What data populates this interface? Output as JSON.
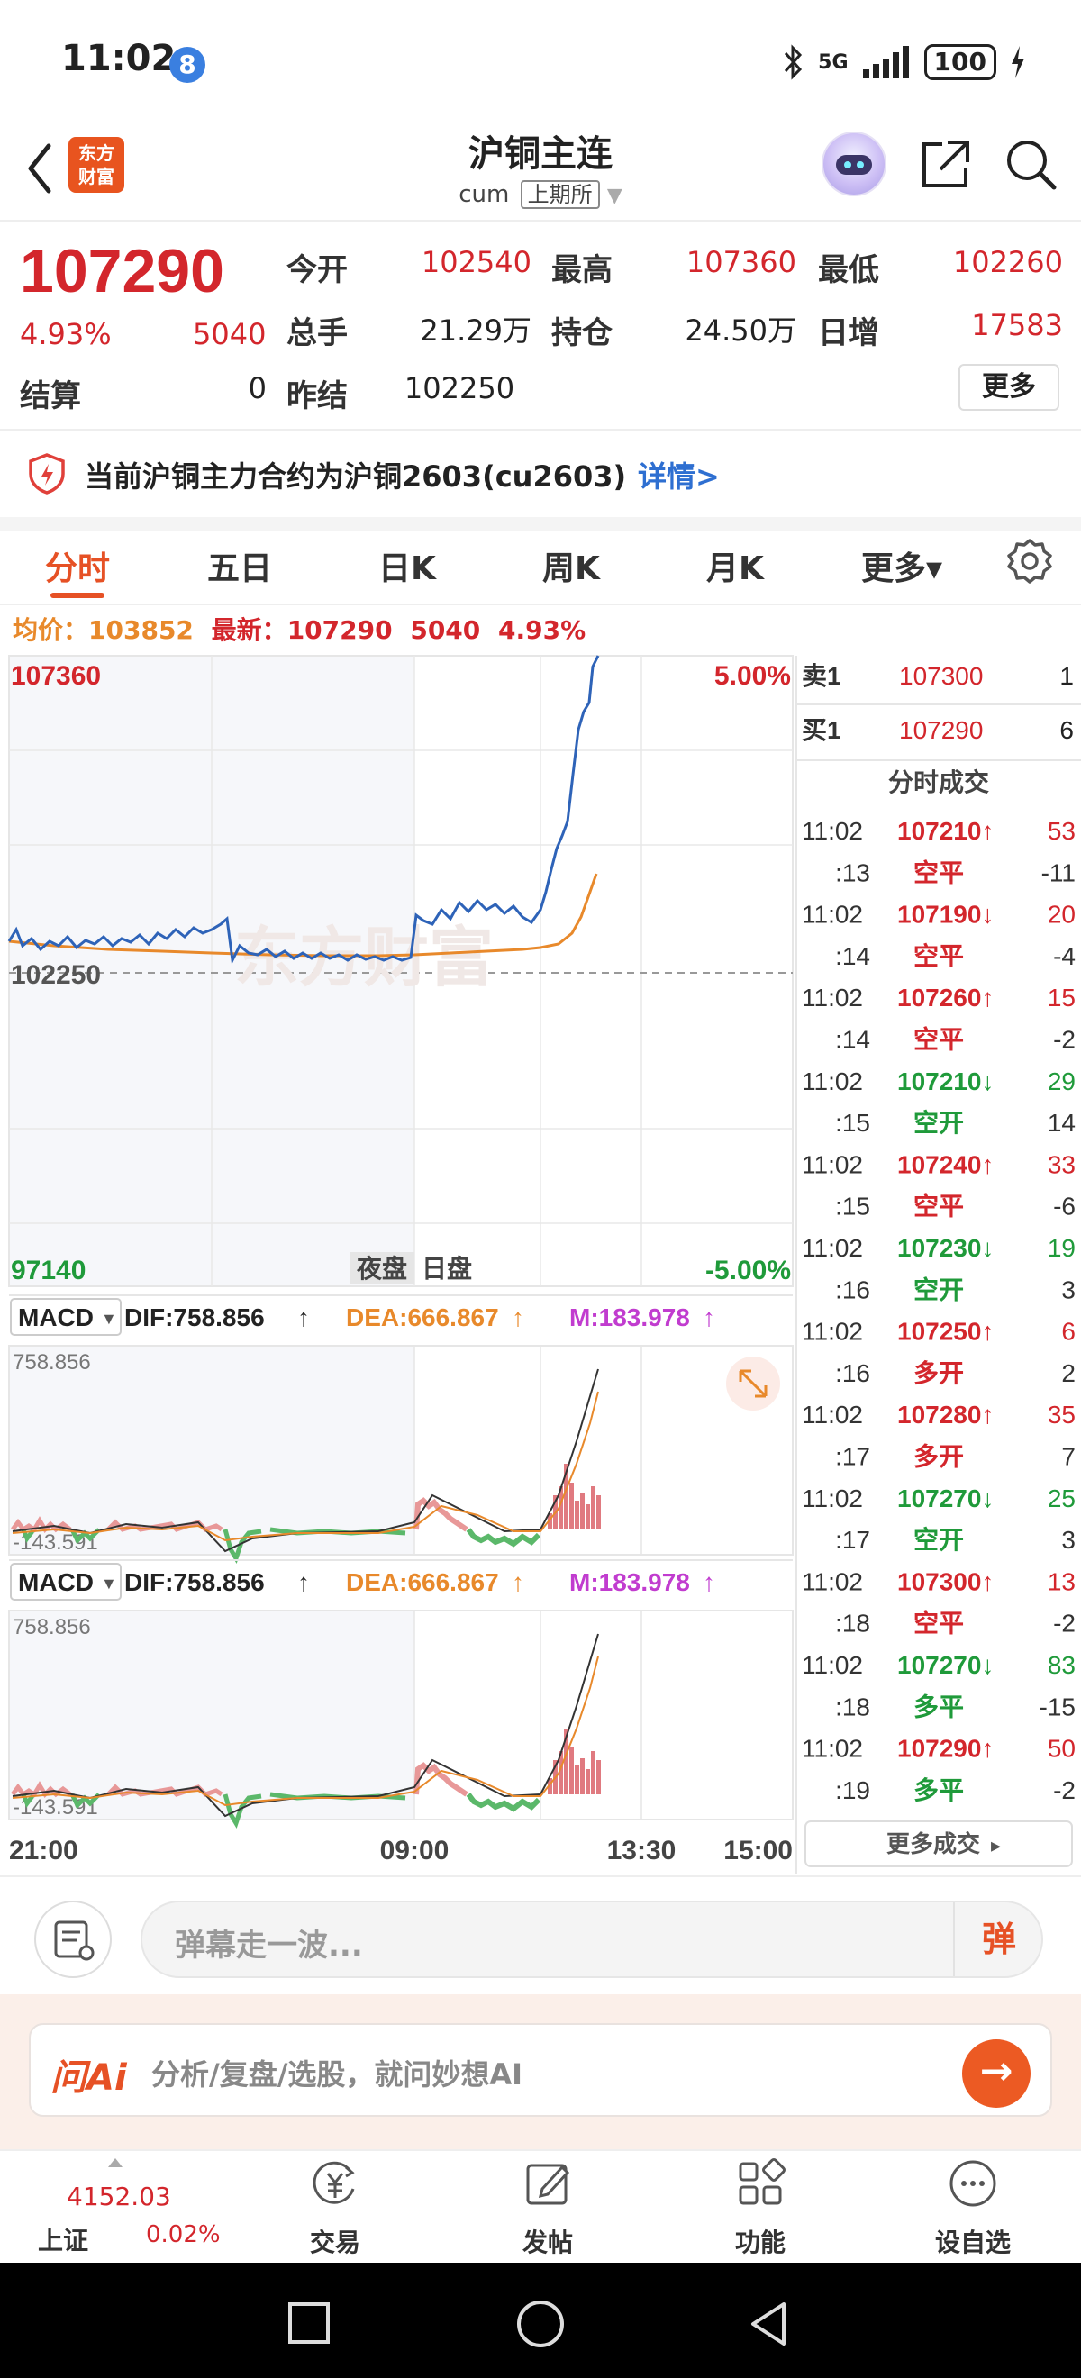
{
  "status_bar": {
    "time": "11:02",
    "badge": "8",
    "network": "5G",
    "battery": "100"
  },
  "header": {
    "title": "沪铜主连",
    "code": "cum",
    "exchange": "上期所",
    "logo_line1": "东方",
    "logo_line2": "财富"
  },
  "quote": {
    "price": "107290",
    "change_pct": "4.93%",
    "change": "5040",
    "open_label": "今开",
    "open": "102540",
    "high_label": "最高",
    "high": "107360",
    "low_label": "最低",
    "low": "102260",
    "volume_label": "总手",
    "volume": "21.29万",
    "oi_label": "持仓",
    "oi": "24.50万",
    "oi_chg_label": "日增",
    "oi_chg": "17583",
    "settle_label": "结算",
    "settle": "0",
    "prev_settle_label": "昨结",
    "prev_settle": "102250",
    "more_label": "更多"
  },
  "notice": {
    "text": "当前沪铜主力合约为沪铜2603(cu2603)",
    "link": "详情>"
  },
  "tabs": [
    {
      "label": "分时",
      "active": true
    },
    {
      "label": "五日"
    },
    {
      "label": "日K"
    },
    {
      "label": "周K"
    },
    {
      "label": "月K"
    },
    {
      "label": "更多▾"
    }
  ],
  "info_line": {
    "avg_label": "均价：",
    "avg": "103852",
    "latest_label": "最新：",
    "latest": "107290",
    "change": "5040",
    "pct": "4.93%"
  },
  "chart": {
    "y_max": "107360",
    "y_ref": "102250",
    "y_min": "97140",
    "pct_max": "5.00%",
    "pct_min": "-5.00%",
    "session_night": "夜盘",
    "session_day": "日盘",
    "watermark": "东方财富",
    "times": [
      "21:00",
      "09:00",
      "13:30",
      "15:00"
    ],
    "macd": {
      "name": "MACD",
      "dif": "DIF:758.856",
      "dea": "DEA:666.867",
      "m": "M:183.978",
      "top": "758.856",
      "bottom": "-143.591"
    }
  },
  "orderbook": {
    "sell_label": "卖1",
    "sell_price": "107300",
    "sell_qty": "1",
    "buy_label": "买1",
    "buy_price": "107290",
    "buy_qty": "6",
    "trades_title": "分时成交",
    "more_trades": "更多成交"
  },
  "trades": [
    {
      "time": "11:02",
      "price": "107210↑",
      "qty": "53",
      "up": true
    },
    {
      "time": ":13",
      "price": "空平",
      "qty": "-11",
      "up": true
    },
    {
      "time": "11:02",
      "price": "107190↓",
      "qty": "20",
      "up": true,
      "arrowdown": true
    },
    {
      "time": ":14",
      "price": "空平",
      "qty": "-4",
      "up": true
    },
    {
      "time": "11:02",
      "price": "107260↑",
      "qty": "15",
      "up": true
    },
    {
      "time": ":14",
      "price": "空平",
      "qty": "-2",
      "up": true
    },
    {
      "time": "11:02",
      "price": "107210↓",
      "qty": "29",
      "up": false
    },
    {
      "time": ":15",
      "price": "空开",
      "qty": "14",
      "up": false
    },
    {
      "time": "11:02",
      "price": "107240↑",
      "qty": "33",
      "up": true
    },
    {
      "time": ":15",
      "price": "空平",
      "qty": "-6",
      "up": true
    },
    {
      "time": "11:02",
      "price": "107230↓",
      "qty": "19",
      "up": false
    },
    {
      "time": ":16",
      "price": "空开",
      "qty": "3",
      "up": false
    },
    {
      "time": "11:02",
      "price": "107250↑",
      "qty": "6",
      "up": true
    },
    {
      "time": ":16",
      "price": "多开",
      "qty": "2",
      "up": true
    },
    {
      "time": "11:02",
      "price": "107280↑",
      "qty": "35",
      "up": true
    },
    {
      "time": ":17",
      "price": "多开",
      "qty": "7",
      "up": true
    },
    {
      "time": "11:02",
      "price": "107270↓",
      "qty": "25",
      "up": false
    },
    {
      "time": ":17",
      "price": "空开",
      "qty": "3",
      "up": false
    },
    {
      "time": "11:02",
      "price": "107300↑",
      "qty": "13",
      "up": true
    },
    {
      "time": ":18",
      "price": "空平",
      "qty": "-2",
      "up": true
    },
    {
      "time": "11:02",
      "price": "107270↓",
      "qty": "83",
      "up": false
    },
    {
      "time": ":18",
      "price": "多平",
      "qty": "-15",
      "up": false
    },
    {
      "time": "11:02",
      "price": "107290↑",
      "qty": "50",
      "up": true
    },
    {
      "time": ":19",
      "price": "多平",
      "qty": "-2",
      "up": false
    }
  ],
  "danmu": {
    "placeholder": "弹幕走一波...",
    "button": "弹"
  },
  "ai": {
    "logo": "问Ai",
    "text": "分析/复盘/选股，就问妙想AI",
    "button": "→"
  },
  "bottom_nav": {
    "index_value": "4152.03",
    "index_name": "上证",
    "index_pct": "0.02%",
    "items": [
      "交易",
      "发帖",
      "功能",
      "设自选"
    ]
  },
  "colors": {
    "up": "#d3262c",
    "down": "#1f9a3a",
    "accent": "#e65125",
    "line": "#2e63b8",
    "avg": "#e8892b"
  }
}
